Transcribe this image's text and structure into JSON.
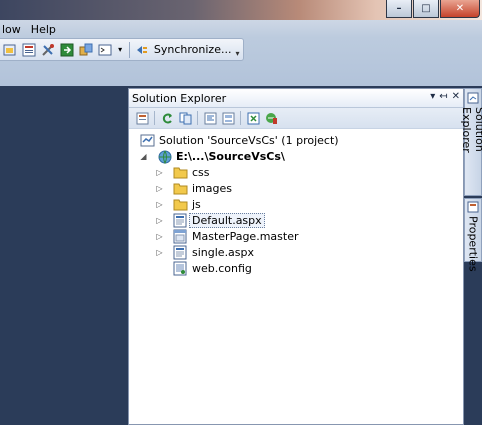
{
  "menu": {
    "items": [
      "low",
      "Help"
    ]
  },
  "toolbar": {
    "sync_label": "Synchronize..."
  },
  "window": {
    "min": "–",
    "max": "□",
    "close": "✕"
  },
  "solution_explorer": {
    "title": "Solution Explorer",
    "controls": {
      "dropdown": "▾",
      "pin": "↤",
      "close": "✕"
    },
    "tree": {
      "solution": "Solution 'SourceVsCs' (1 project)",
      "project": "E:\\...\\SourceVsCs\\",
      "items": [
        "css",
        "images",
        "js",
        "Default.aspx",
        "MasterPage.master",
        "single.aspx",
        "web.config"
      ]
    }
  },
  "side_tabs": {
    "solution_explorer": "Solution Explorer",
    "properties": "Properties"
  },
  "colors": {
    "ide_background": "#2b3c59",
    "panel_background": "#ffffff",
    "folder": "#f2c94c",
    "close_button": "#c5422b"
  }
}
